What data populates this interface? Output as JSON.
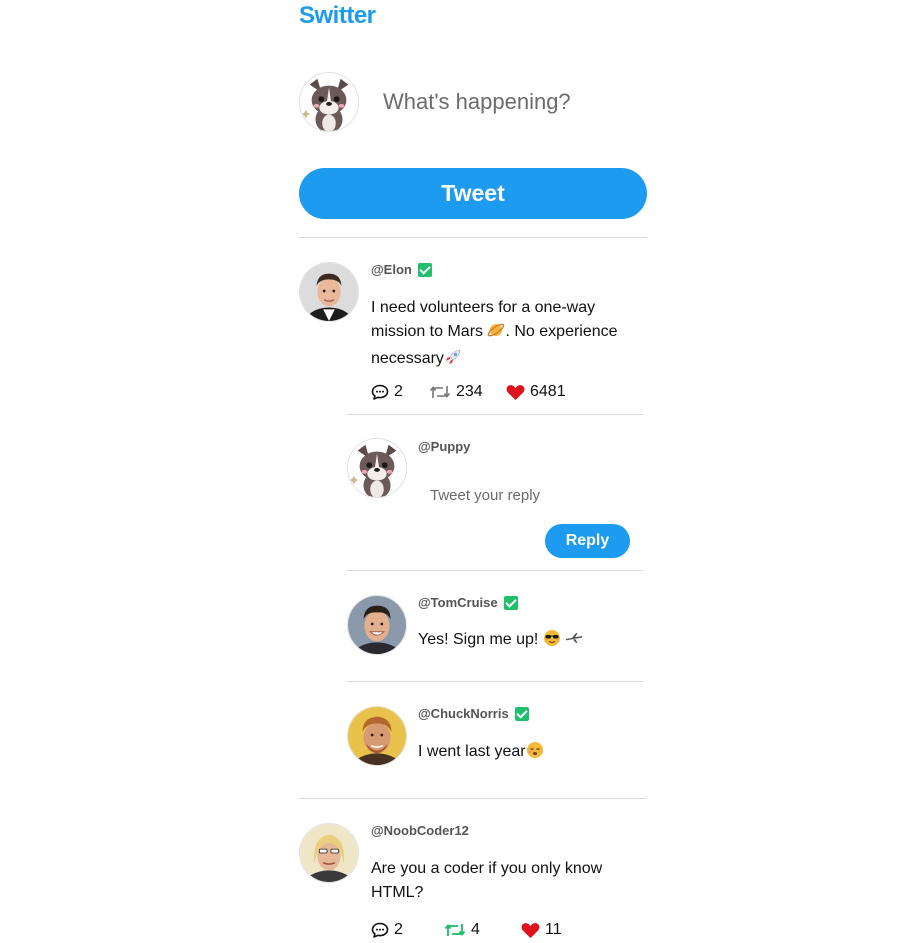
{
  "brand": {
    "title": "Switter"
  },
  "compose": {
    "placeholder": "What's happening?",
    "tweet_label": "Tweet"
  },
  "tweets": [
    {
      "handle": "@Elon",
      "verified": true,
      "text": "I need volunteers for a one-way mission to Mars",
      "text_mid": ". No experience necessary",
      "comments": "2",
      "retweets": "234",
      "likes": "6481"
    },
    {
      "handle": "@NoobCoder12",
      "verified": false,
      "text": "Are you a coder if you only know HTML?",
      "comments": "2",
      "retweets": "4",
      "likes": "11"
    }
  ],
  "reply_box": {
    "handle": "@Puppy",
    "placeholder": "Tweet your reply",
    "reply_label": "Reply"
  },
  "replies": [
    {
      "handle": "@TomCruise",
      "verified": true,
      "text": "Yes! Sign me up!"
    },
    {
      "handle": "@ChuckNorris",
      "verified": true,
      "text": "I went last year"
    }
  ],
  "colors": {
    "accent": "#1d9bf0",
    "verified": "#1fbf6b",
    "like": "#e0121b",
    "retweet_active": "#17bf63"
  },
  "icons": [
    "comment-icon",
    "retweet-icon",
    "heart-icon",
    "verified-check-icon",
    "planet-emoji",
    "rocket-emoji",
    "sunglasses-emoji",
    "airplane-emoji",
    "sleepy-emoji"
  ]
}
